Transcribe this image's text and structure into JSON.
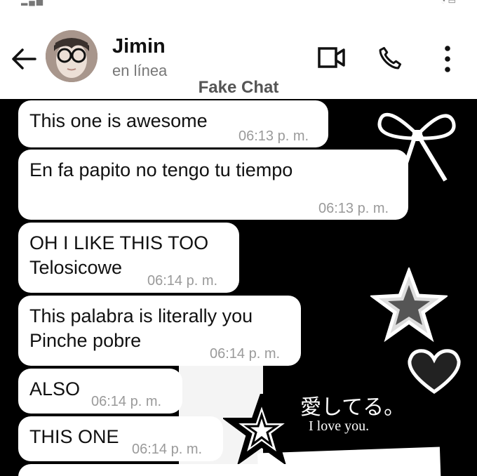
{
  "header": {
    "contact_name": "Jimin",
    "contact_status": "en línea",
    "subtitle": "Fake Chat"
  },
  "background": {
    "kanji_text": "愛してる。",
    "english_text": "I love you."
  },
  "messages": [
    {
      "lines": [
        "This one is awesome"
      ],
      "time": "06:13 p. m."
    },
    {
      "lines": [
        "En fa papito no tengo tu tiempo"
      ],
      "time": "06:13 p. m."
    },
    {
      "lines": [
        "OH I LIKE THIS TOO",
        "Telosicowe"
      ],
      "time": "06:14 p. m."
    },
    {
      "lines": [
        "This palabra is literally you",
        "Pinche pobre"
      ],
      "time": "06:14 p. m."
    },
    {
      "lines": [
        "ALSO"
      ],
      "time": "06:14 p. m."
    },
    {
      "lines": [
        "THIS ONE"
      ],
      "time": "06:14 p. m."
    }
  ],
  "icons": {
    "back": "arrow-left-icon",
    "video": "video-camera-icon",
    "call": "phone-icon",
    "more": "more-vertical-icon"
  }
}
